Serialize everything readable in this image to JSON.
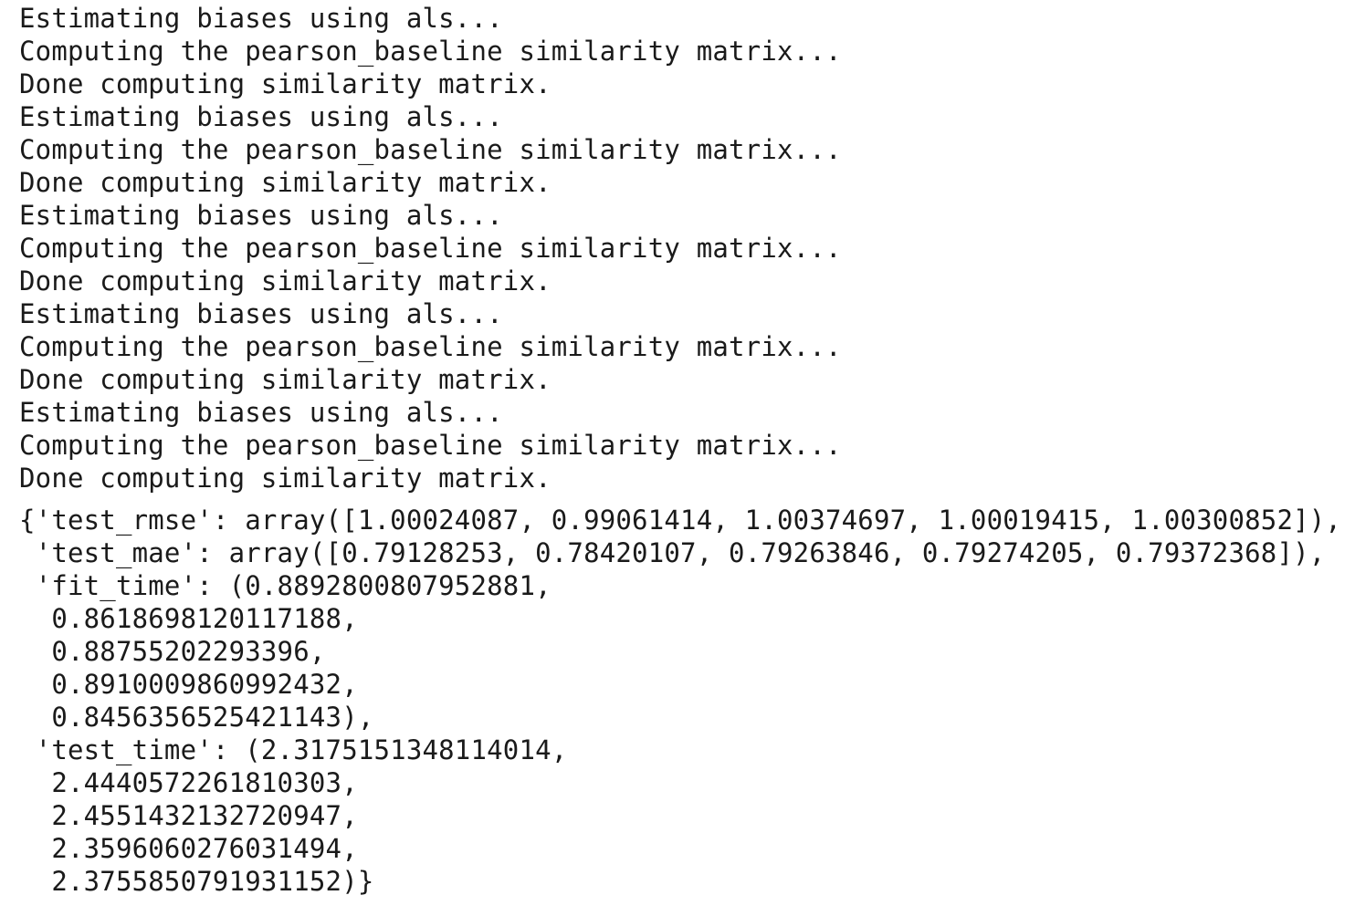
{
  "stream_output": {
    "lines": [
      "Estimating biases using als...",
      "Computing the pearson_baseline similarity matrix...",
      "Done computing similarity matrix.",
      "Estimating biases using als...",
      "Computing the pearson_baseline similarity matrix...",
      "Done computing similarity matrix.",
      "Estimating biases using als...",
      "Computing the pearson_baseline similarity matrix...",
      "Done computing similarity matrix.",
      "Estimating biases using als...",
      "Computing the pearson_baseline similarity matrix...",
      "Done computing similarity matrix.",
      "Estimating biases using als...",
      "Computing the pearson_baseline similarity matrix...",
      "Done computing similarity matrix."
    ]
  },
  "result_output": {
    "lines": [
      "{'test_rmse': array([1.00024087, 0.99061414, 1.00374697, 1.00019415, 1.00300852]),",
      " 'test_mae': array([0.79128253, 0.78420107, 0.79263846, 0.79274205, 0.79372368]),",
      " 'fit_time': (0.8892800807952881,",
      "  0.8618698120117188,",
      "  0.88755202293396,",
      "  0.8910009860992432,",
      "  0.8456356525421143),",
      " 'test_time': (2.3175151348114014,",
      "  2.4440572261810303,",
      "  2.4551432132720947,",
      "  2.3596060276031494,",
      "  2.3755850791931152)}"
    ]
  }
}
